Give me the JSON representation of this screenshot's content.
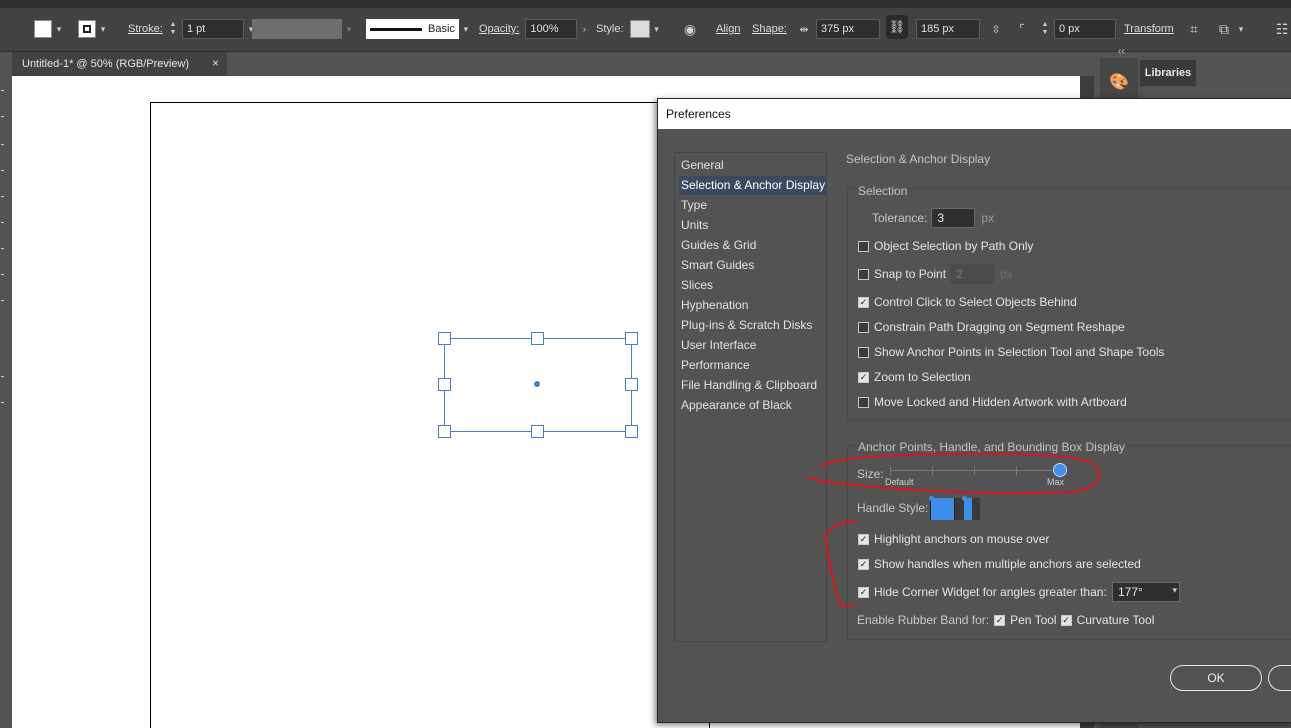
{
  "control_bar": {
    "stroke_label": "Stroke:",
    "stroke_weight": "1 pt",
    "brush_label": "Basic",
    "opacity_label": "Opacity:",
    "opacity_value": "100%",
    "style_label": "Style:",
    "align_label": "Align",
    "shape_label": "Shape:",
    "width_value": "375 px",
    "height_value": "185 px",
    "corner_value": "0 px",
    "transform_label": "Transform"
  },
  "document": {
    "tab_title": "Untitled-1* @ 50% (RGB/Preview)",
    "close_glyph": "×"
  },
  "right_panel": {
    "libraries_tab": "Libraries",
    "collapse_glyph": "‹‹"
  },
  "preferences": {
    "title": "Preferences",
    "categories": [
      {
        "label": "General",
        "selected": false
      },
      {
        "label": "Selection & Anchor Display",
        "selected": true
      },
      {
        "label": "Type",
        "selected": false
      },
      {
        "label": "Units",
        "selected": false
      },
      {
        "label": "Guides & Grid",
        "selected": false
      },
      {
        "label": "Smart Guides",
        "selected": false
      },
      {
        "label": "Slices",
        "selected": false
      },
      {
        "label": "Hyphenation",
        "selected": false
      },
      {
        "label": "Plug-ins & Scratch Disks",
        "selected": false
      },
      {
        "label": "User Interface",
        "selected": false
      },
      {
        "label": "Performance",
        "selected": false
      },
      {
        "label": "File Handling & Clipboard",
        "selected": false
      },
      {
        "label": "Appearance of Black",
        "selected": false
      }
    ],
    "section_title": "Selection & Anchor Display",
    "selection": {
      "group_title": "Selection",
      "tolerance_label": "Tolerance:",
      "tolerance_value": "3",
      "tolerance_unit": "px",
      "object_selection_by_path": {
        "label": "Object Selection by Path Only",
        "checked": false
      },
      "snap_to_point": {
        "label": "Snap to Point",
        "checked": false,
        "value": "2",
        "unit": "px"
      },
      "control_click": {
        "label": "Control Click to Select Objects Behind",
        "checked": true
      },
      "constrain_path": {
        "label": "Constrain Path Dragging on Segment Reshape",
        "checked": false
      },
      "show_anchor_points": {
        "label": "Show Anchor Points in Selection Tool and Shape Tools",
        "checked": false
      },
      "zoom_to_selection": {
        "label": "Zoom to Selection",
        "checked": true
      },
      "move_locked": {
        "label": "Move Locked and Hidden Artwork with Artboard",
        "checked": false
      }
    },
    "anchor_display": {
      "group_title": "Anchor Points, Handle, and Bounding Box Display",
      "size_label": "Size:",
      "size_min_label": "Default",
      "size_max_label": "Max",
      "size_level": 1.0,
      "handle_style_label": "Handle Style:",
      "highlight_anchors": {
        "label": "Highlight anchors on mouse over",
        "checked": true
      },
      "show_handles_multiple": {
        "label": "Show handles when multiple anchors are selected",
        "checked": true
      },
      "hide_corner_widget": {
        "label": "Hide Corner Widget for angles greater than:",
        "checked": true,
        "value": "177°"
      },
      "rubber_band_label": "Enable Rubber Band for:",
      "pen_tool": {
        "label": "Pen Tool",
        "checked": true
      },
      "curvature_tool": {
        "label": "Curvature Tool",
        "checked": true
      }
    },
    "ok_label": "OK"
  }
}
